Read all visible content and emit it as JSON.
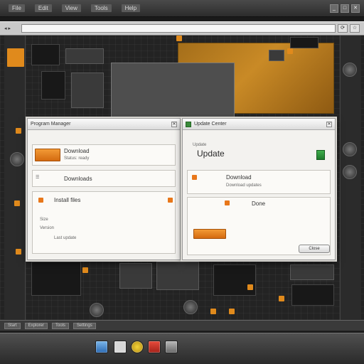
{
  "menubar": {
    "items": [
      "File",
      "Edit",
      "View",
      "Tools",
      "Help"
    ],
    "window_controls": [
      "_",
      "□",
      "✕"
    ]
  },
  "toolbar": {
    "back_label": "◂ ▸",
    "address": "",
    "buttons": [
      "⟳",
      "☆"
    ]
  },
  "dialog_left": {
    "title": "Program Manager",
    "close": "✕",
    "row1": {
      "heading": "Download",
      "subtext": "Status: ready"
    },
    "row2": {
      "heading": "Downloads"
    },
    "row3": {
      "heading": "Install files"
    },
    "details": [
      "Size",
      "Version",
      "Last update"
    ]
  },
  "dialog_right": {
    "title": "Update Center",
    "close": "✕",
    "header_label": "Update",
    "big_title": "Update",
    "row1": {
      "heading": "Download",
      "subtext": "Download updates"
    },
    "row2": {
      "heading": "Done"
    },
    "button_label": "Close"
  },
  "strip": {
    "items": [
      "Start",
      "Explorer",
      "Tools",
      "Settings"
    ]
  },
  "taskbar": {
    "icons": [
      "explorer-icon",
      "browser-icon",
      "mail-icon",
      "tools-icon"
    ]
  },
  "colors": {
    "accent_orange": "#e8771a",
    "gold": "#c98a26",
    "board": "#232323",
    "dialog_bg": "#f3f2ef"
  }
}
